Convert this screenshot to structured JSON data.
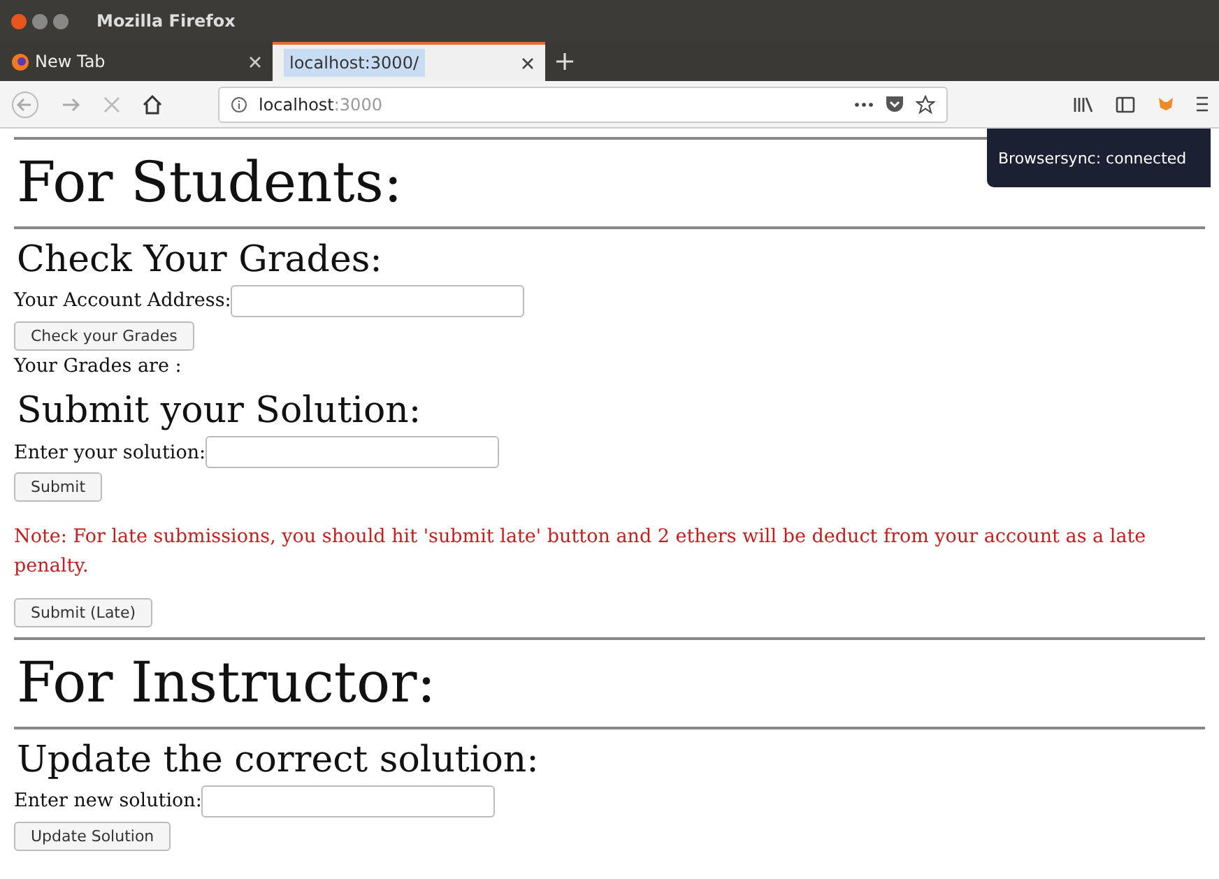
{
  "window": {
    "title": "Mozilla Firefox"
  },
  "tabs": [
    {
      "label": "New Tab",
      "selected": false
    },
    {
      "label": "localhost:3000/",
      "selected": true
    }
  ],
  "address_bar": {
    "host": "localhost",
    "port": ":3000"
  },
  "toast": {
    "text": "Browsersync: connected"
  },
  "content": [
    {
      "kind": "rule"
    },
    {
      "kind": "h1",
      "text": "For Students:"
    },
    {
      "kind": "rule"
    },
    {
      "kind": "h2",
      "text": "Check Your Grades:"
    },
    {
      "kind": "field",
      "label": "Your Account Address:"
    },
    {
      "kind": "button",
      "text": "Check your Grades"
    },
    {
      "kind": "text",
      "text": "Your Grades are :"
    },
    {
      "kind": "h2",
      "text": "Submit your Solution:"
    },
    {
      "kind": "field",
      "label": "Enter your solution:"
    },
    {
      "kind": "button",
      "text": "Submit"
    },
    {
      "kind": "note",
      "text": "Note: For late submissions, you should hit 'submit late' button and 2 ethers will be deduct from your account as a late penalty."
    },
    {
      "kind": "button",
      "text": "Submit (Late)"
    },
    {
      "kind": "rule"
    },
    {
      "kind": "h1",
      "text": "For Instructor:"
    },
    {
      "kind": "rule"
    },
    {
      "kind": "h2",
      "text": "Update the correct solution:"
    },
    {
      "kind": "field",
      "label": "Enter new solution:"
    },
    {
      "kind": "button",
      "text": "Update Solution"
    }
  ]
}
